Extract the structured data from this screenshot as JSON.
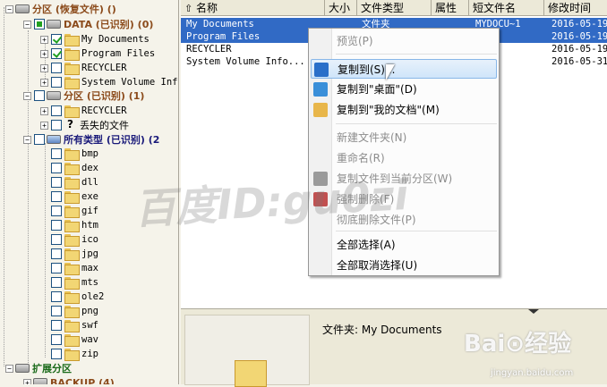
{
  "tree": {
    "root": "分区 (恢复文件) ()",
    "data_partition": "DATA (已识别) (0)",
    "data_children": [
      "My Documents",
      "Program Files",
      "RECYCLER",
      "System Volume Inf"
    ],
    "recognized_partition": "分区 (已识别) (1)",
    "recognized_children": [
      "RECYCLER",
      "丢失的文件"
    ],
    "all_types": "所有类型 (已识别) (2",
    "types": [
      "bmp",
      "dex",
      "dll",
      "exe",
      "gif",
      "htm",
      "ico",
      "jpg",
      "max",
      "mts",
      "ole2",
      "png",
      "swf",
      "wav",
      "zip"
    ],
    "extended": "扩展分区",
    "backup": "BACKUP (4)"
  },
  "list": {
    "columns": [
      "名称",
      "大小",
      "文件类型",
      "属性",
      "短文件名",
      "修改时间"
    ],
    "rows": [
      {
        "name": "My Documents",
        "size": "",
        "type": "文件夹",
        "attr": "",
        "short": "MYDOCU~1",
        "date": "2016-05-19",
        "selected": true
      },
      {
        "name": "Program Files",
        "size": "",
        "type": "",
        "attr": "R",
        "short": "RA~1",
        "date": "2016-05-19",
        "selected": true
      },
      {
        "name": "RECYCLER",
        "size": "",
        "type": "",
        "attr": "",
        "short": "CLER",
        "date": "2016-05-19",
        "selected": false
      },
      {
        "name": "System Volume Info...",
        "size": "",
        "type": "",
        "attr": "",
        "short": "EM~1",
        "date": "2016-05-31",
        "selected": false
      }
    ]
  },
  "menu": {
    "items": [
      {
        "label": "预览(P)",
        "disabled": true
      },
      {
        "label": "复制到(S)...",
        "disabled": false,
        "highlight": true
      },
      {
        "label": "复制到\"桌面\"(D)",
        "disabled": false
      },
      {
        "label": "复制到\"我的文档\"(M)",
        "disabled": false
      },
      {
        "label": "新建文件夹(N)",
        "disabled": true
      },
      {
        "label": "重命名(R)",
        "disabled": true
      },
      {
        "label": "复制文件到当前分区(W)",
        "disabled": true
      },
      {
        "label": "强制删除(F)",
        "disabled": true
      },
      {
        "label": "彻底删除文件(P)",
        "disabled": true
      },
      {
        "label": "全部选择(A)",
        "disabled": false
      },
      {
        "label": "全部取消选择(U)",
        "disabled": false
      }
    ]
  },
  "preview": {
    "text": "文件夹: My Documents"
  },
  "watermark": "百度ID:gu0zi",
  "logo": {
    "main": "Bai⊙经验",
    "sub": "jingyan.baidu.com"
  }
}
